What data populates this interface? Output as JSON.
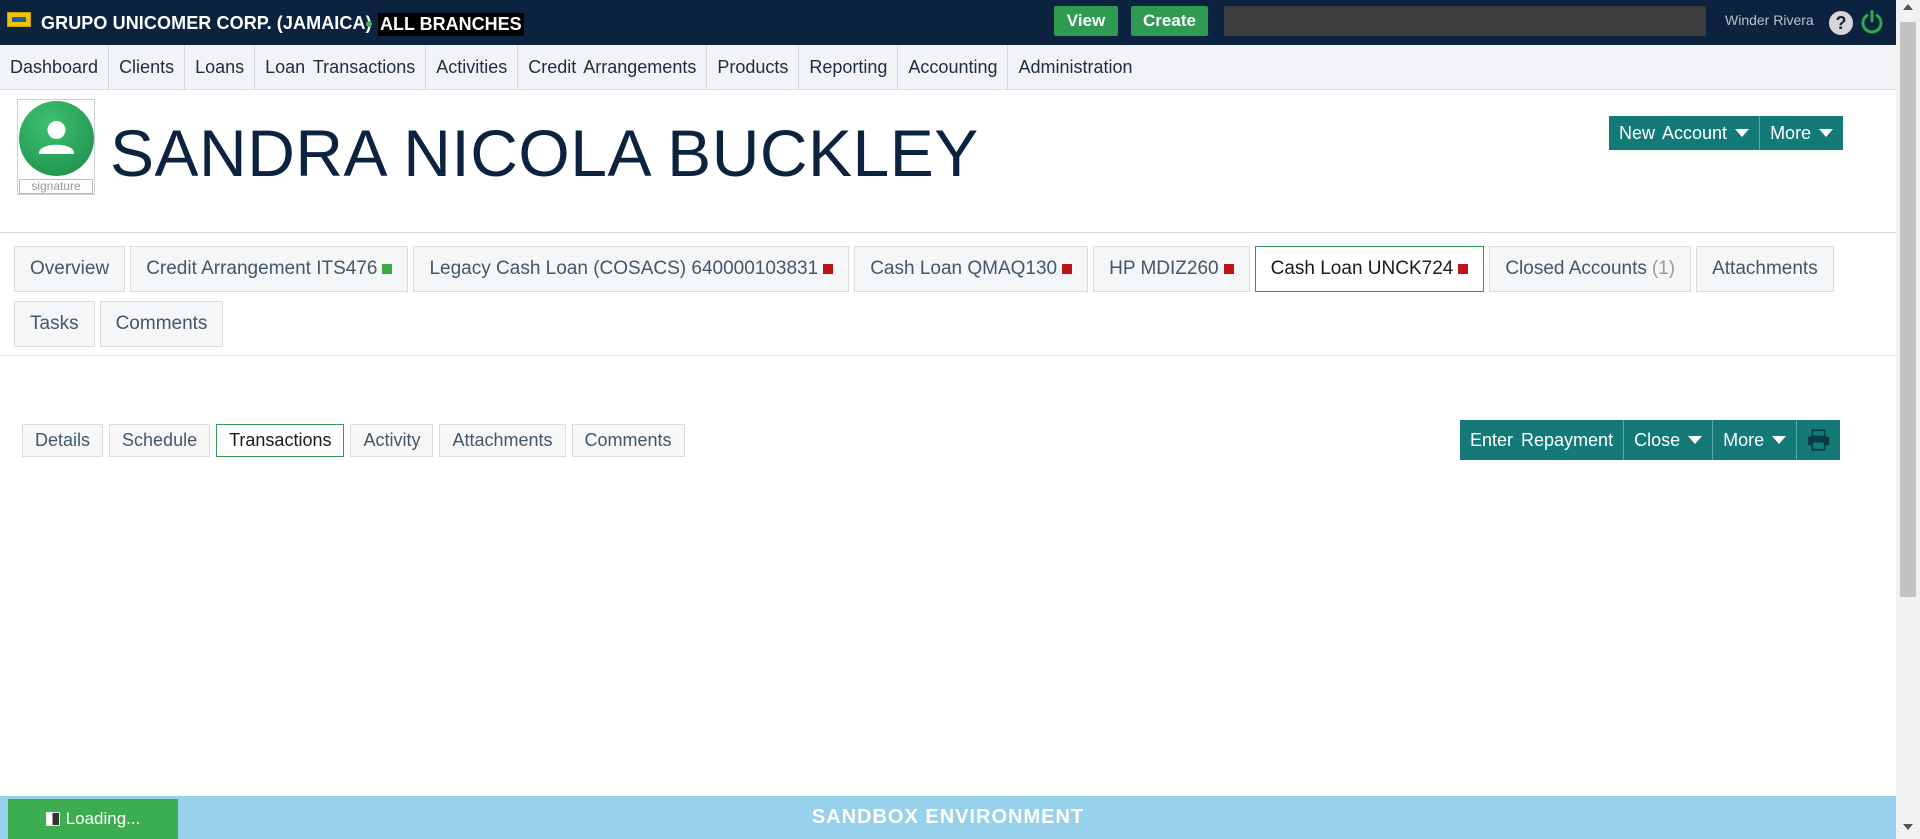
{
  "topbar": {
    "org_name": "GRUPO UNICOMER CORP. (JAMAICA)",
    "branch": "ALL BRANCHES",
    "view_label": "View",
    "create_label": "Create",
    "search_value": "",
    "username": "Winder Rivera",
    "help_symbol": "?",
    "icons": [
      "logo-icon",
      "help-icon",
      "power-icon"
    ],
    "colors": {
      "bar_bg": "#0c2340",
      "button_green": "#2e9a52",
      "power_green": "#2fa84f"
    }
  },
  "nav": {
    "items": [
      "Dashboard",
      "Clients",
      "Loans",
      "Loan Transactions",
      "Activities",
      "Credit Arrangements",
      "Products",
      "Reporting",
      "Accounting",
      "Administration"
    ]
  },
  "client": {
    "name": "SANDRA NICOLA BUCKLEY",
    "signature_label": "signature",
    "avatar_icon": "user-avatar-icon"
  },
  "header_actions": {
    "new_account": "New Account",
    "more": "More"
  },
  "account_tabs": {
    "overview": "Overview",
    "credit_arrangement": "Credit Arrangement ITS476",
    "legacy_cash_loan": "Legacy Cash Loan (COSACS) 640000103831",
    "cash_loan_qmaq": "Cash Loan QMAQ130",
    "hp_mdiz": "HP MDIZ260",
    "cash_loan_unck": "Cash Loan UNCK724",
    "closed_accounts": "Closed Accounts",
    "closed_count": "(1)",
    "attachments": "Attachments",
    "tasks": "Tasks",
    "comments": "Comments",
    "status_colors": {
      "green": "#3aab4a",
      "red": "#c0141b"
    }
  },
  "sub_tabs": {
    "details": "Details",
    "schedule": "Schedule",
    "transactions": "Transactions",
    "activity": "Activity",
    "attachments": "Attachments",
    "comments": "Comments"
  },
  "loan_actions": {
    "enter_repayment": "Enter Repayment",
    "close": "Close",
    "more": "More",
    "print_icon": "printer-icon"
  },
  "footer": {
    "environment": "SANDBOX ENVIRONMENT",
    "loading": "Loading..."
  }
}
